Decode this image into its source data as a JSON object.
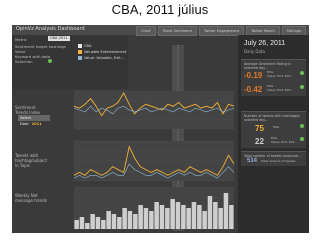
{
  "slide_title": "CBA, 2011 július",
  "app": {
    "title": "OpinVz Analysis Dashboard",
    "tabs": [
      "Chart",
      "Tweet Sentiment",
      "Twitter Engagement",
      "Twitter Reach",
      "Settings"
    ]
  },
  "controls": {
    "metric_label": "Metric",
    "metric_value": "CBA 2011",
    "rows": [
      "Sentiment target hashtags",
      "Value",
      "Keyword with data",
      "Selection"
    ],
    "legend": [
      {
        "label": "CBA",
        "color": "#e8e8e8"
      },
      {
        "label": "Valuable Entertainment",
        "color": "#f2b233"
      },
      {
        "label": "Value: Valuable, Exit...",
        "color": "#8fb8d6"
      },
      {
        "label": "",
        "color": "#555"
      }
    ]
  },
  "sections": {
    "sentiment": "Sentiment\nTrends Index",
    "tweets": "Tweets with\nhashtag/subject\nin Topic",
    "weekly": "Weekly Net\nmessage trends"
  },
  "date_box": {
    "label": "Select Date",
    "value": "2011"
  },
  "side": {
    "date": "July 26, 2011",
    "day": "Daily Data",
    "cards": [
      {
        "head": "Average Sentiment Rating in\nselected day...",
        "value": "-0.19",
        "value_color": "#e07a2c",
        "sub": "Mhs\nValue: Exit, Exit...",
        "dot": "#6bbf59"
      },
      {
        "head": "",
        "value": "-0.42",
        "value_color": "#e07a2c",
        "sub": "Mhs\nValue: Exit, Exit...",
        "dot": "#6bbf59"
      },
      {
        "head": "Number of tweets with hashtag/in\nselected day...",
        "value": "75",
        "value_color": "#f2b233",
        "sub": "Mhs",
        "dot": "#6bbf59"
      },
      {
        "head": "",
        "value": "22",
        "value_color": "#cfcfcf",
        "sub": "Mhs\nValue: Exit, Exit...",
        "dot": "#6bbf59"
      },
      {
        "head": "Total number of tweets analyzed...",
        "value": "514",
        "value_color": "#9ad",
        "sub": "Total amount of tweets",
        "dot": ""
      }
    ]
  },
  "chart_data": [
    {
      "type": "line",
      "title": "",
      "series": [
        {
          "name": "",
          "color": "#f2b233",
          "values": [
            0.2,
            0.1,
            0.3,
            0.6,
            0.2,
            -0.3,
            0.1,
            0.2,
            0.4,
            0.9,
            0.3,
            -0.2,
            0.1,
            0.3,
            0.2,
            0.1,
            0.0,
            0.3,
            0.2,
            0.4,
            0.1,
            0.2,
            0.3,
            0.1,
            0.2,
            0.1,
            0.4,
            -0.2,
            0.3,
            0.2
          ]
        },
        {
          "name": "",
          "color": "#8fb8d6",
          "values": [
            0.1,
            0.0,
            -0.1,
            0.2,
            -0.1,
            0.1,
            0.0,
            -0.2,
            0.1,
            0.2,
            0.0,
            -0.1,
            0.0,
            0.1,
            -0.1,
            0.0,
            0.1,
            0.0,
            -0.1,
            0.1,
            0.0,
            -0.1,
            0.1,
            0.0,
            -0.1,
            0.0,
            0.1,
            -0.1,
            0.0,
            0.1
          ]
        }
      ],
      "ylim": [
        -1,
        1
      ]
    },
    {
      "type": "line",
      "series": [
        {
          "name": "",
          "color": "#f2b233",
          "values": [
            2,
            3,
            2,
            4,
            3,
            2,
            3,
            5,
            4,
            3,
            12,
            8,
            5,
            4,
            3,
            4,
            3,
            2,
            3,
            4,
            3,
            5,
            4,
            3,
            4,
            3,
            2,
            5,
            9,
            6
          ]
        },
        {
          "name": "",
          "color": "#8fb8d6",
          "values": [
            1,
            2,
            1,
            2,
            2,
            1,
            2,
            3,
            2,
            2,
            6,
            4,
            3,
            2,
            2,
            3,
            2,
            1,
            2,
            3,
            2,
            3,
            2,
            2,
            3,
            2,
            1,
            3,
            5,
            3
          ]
        }
      ],
      "ylim": [
        0,
        14
      ]
    },
    {
      "type": "bar",
      "values": [
        3,
        4,
        2,
        5,
        4,
        3,
        6,
        5,
        4,
        7,
        6,
        5,
        8,
        7,
        6,
        9,
        8,
        7,
        10,
        9,
        8,
        7,
        9,
        8,
        6,
        11,
        9,
        7,
        12,
        8
      ],
      "color": "#cfcfcf",
      "ylim": [
        0,
        14
      ]
    }
  ]
}
